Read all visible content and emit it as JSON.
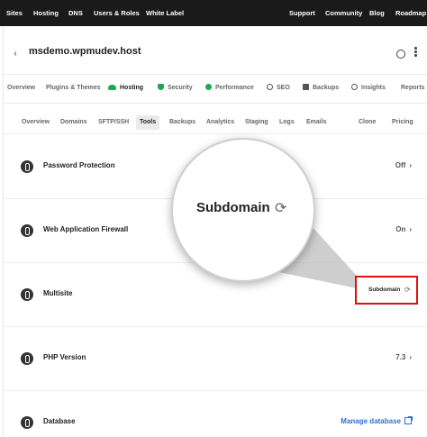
{
  "topnav": {
    "left": [
      "Sites",
      "Hosting",
      "DNS",
      "Users & Roles",
      "White Label"
    ],
    "right": [
      "Support",
      "Community",
      "Blog",
      "Roadmap"
    ]
  },
  "site": {
    "title": "msdemo.wpmudev.host"
  },
  "services": [
    {
      "label": "Overview",
      "icon": ""
    },
    {
      "label": "Plugins & Themes",
      "icon": ""
    },
    {
      "label": "Hosting",
      "icon": "cloud-icon",
      "color": "#1aa94e"
    },
    {
      "label": "Security",
      "icon": "shield-icon",
      "color": "#1aa94e"
    },
    {
      "label": "Performance",
      "icon": "gauge-icon",
      "color": "#1aa94e"
    },
    {
      "label": "SEO",
      "icon": "seo-icon",
      "color": "#555555"
    },
    {
      "label": "Backups",
      "icon": "backups-icon",
      "color": "#555555"
    },
    {
      "label": "Insights",
      "icon": "insights-icon",
      "color": "#555555"
    },
    {
      "label": "Reports",
      "icon": ""
    }
  ],
  "tabs": [
    "Overview",
    "Domains",
    "SFTP/SSH",
    "Tools",
    "Backups",
    "Analytics",
    "Staging",
    "Logs",
    "Emails",
    "Clone",
    "Pricing"
  ],
  "active_tab": "Tools",
  "tools": [
    {
      "label": "Password Protection",
      "value": "Off",
      "chevron": "›"
    },
    {
      "label": "Web Application Firewall",
      "value": "On",
      "chevron": "›"
    },
    {
      "label": "Multisite",
      "value": "Subdomain"
    },
    {
      "label": "PHP Version",
      "value": "7.3",
      "chevron": "›"
    },
    {
      "label": "Database",
      "value": "Manage database",
      "link": true
    }
  ],
  "magnifier": {
    "text": "Subdomain",
    "icon": "sync-icon"
  },
  "callout": {
    "text": "Subdomain",
    "icon": "sync-icon"
  },
  "colors": {
    "accent": "#1aa94e",
    "link": "#2f6fd6",
    "highlight": "#e01010",
    "topbar": "#1a1a1a"
  },
  "icons": {
    "sync": "⟳"
  }
}
